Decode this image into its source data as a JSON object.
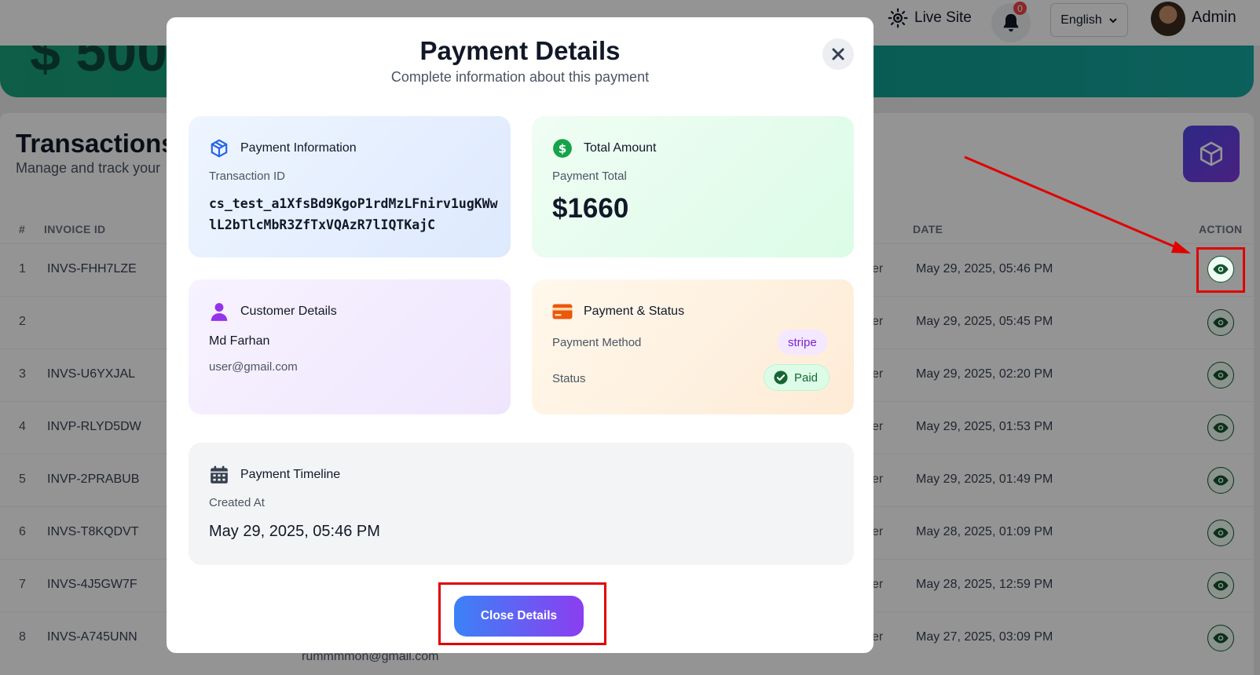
{
  "header": {
    "live_site_label": "Live Site",
    "notification_count": "0",
    "language": "English",
    "user_name": "Admin"
  },
  "banner": {
    "amount_partial": "$ 500"
  },
  "transactions": {
    "title": "Transactions",
    "subtitle": "Manage and track your",
    "columns": {
      "num": "#",
      "invoice": "INVOICE ID",
      "date": "DATE",
      "action": "ACTION"
    },
    "rows": [
      {
        "num": "1",
        "invoice": "INVS-FHH7LZE",
        "tail": "er",
        "date": "May 29, 2025, 05:46 PM"
      },
      {
        "num": "2",
        "invoice": "",
        "tail": "er",
        "date": "May 29, 2025, 05:45 PM"
      },
      {
        "num": "3",
        "invoice": "INVS-U6YXJAL",
        "tail": "er",
        "date": "May 29, 2025, 02:20 PM"
      },
      {
        "num": "4",
        "invoice": "INVP-RLYD5DW",
        "tail": "er",
        "date": "May 29, 2025, 01:53 PM"
      },
      {
        "num": "5",
        "invoice": "INVP-2PRABUB",
        "tail": "er",
        "date": "May 29, 2025, 01:49 PM"
      },
      {
        "num": "6",
        "invoice": "INVS-T8KQDVT",
        "tail": "er",
        "date": "May 28, 2025, 01:09 PM"
      },
      {
        "num": "7",
        "invoice": "INVS-4J5GW7F",
        "tail": "er",
        "date": "May 28, 2025, 12:59 PM"
      },
      {
        "num": "8",
        "invoice": "INVS-A745UNN",
        "tail": "er",
        "date": "May 27, 2025, 03:09 PM"
      }
    ],
    "partial_email": "rummmmon@gmail.com"
  },
  "modal": {
    "title": "Payment Details",
    "subtitle": "Complete information about this payment",
    "payment_info": {
      "heading": "Payment Information",
      "label": "Transaction ID",
      "transaction_id": "cs_test_a1XfsBd9KgoP1rdMzLFnirv1ugKWwlL2bTlcMbR3ZfTxVQAzR7lIQTKajC"
    },
    "total": {
      "heading": "Total Amount",
      "label": "Payment Total",
      "amount": "$1660"
    },
    "customer": {
      "heading": "Customer Details",
      "name": "Md Farhan",
      "email": "user@gmail.com"
    },
    "payment_status": {
      "heading": "Payment & Status",
      "method_label": "Payment Method",
      "method": "stripe",
      "status_label": "Status",
      "status": "Paid"
    },
    "timeline": {
      "heading": "Payment Timeline",
      "label": "Created At",
      "created_at": "May 29, 2025, 05:46 PM"
    },
    "close_button": "Close Details"
  },
  "colors": {
    "accent_start": "#3b82f6",
    "accent_end": "#8b3ef0",
    "annotation_red": "#e00000",
    "success_green": "#166534"
  }
}
